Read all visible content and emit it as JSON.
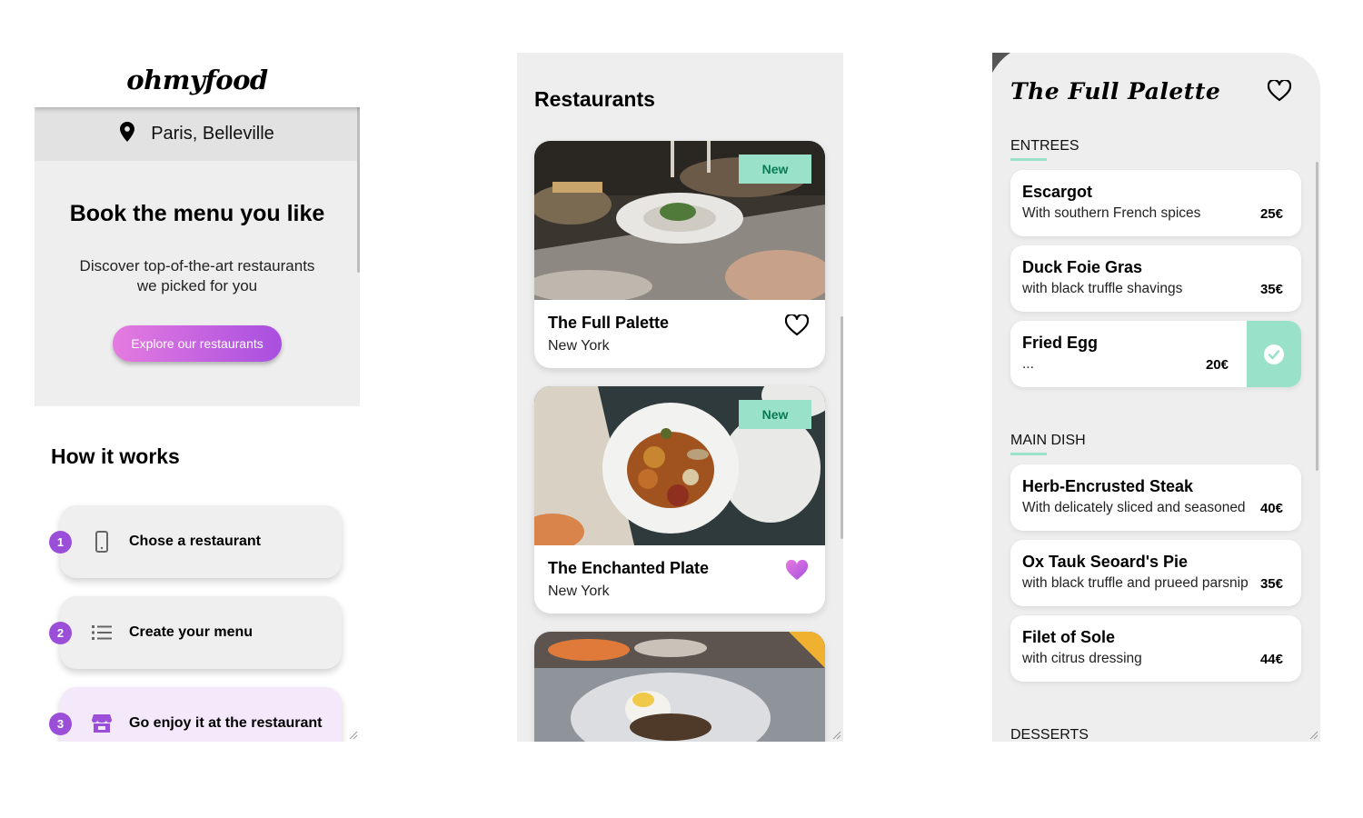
{
  "panel1": {
    "logo": "ohmyfood",
    "location": "Paris, Belleville",
    "hero": {
      "title": "Book the menu you like",
      "subtitle": "Discover top-of-the-art restaurants we picked for you",
      "button": "Explore our restaurants"
    },
    "how": {
      "title": "How it works",
      "steps": [
        {
          "num": "1",
          "label": "Chose a restaurant",
          "icon": "phone-icon"
        },
        {
          "num": "2",
          "label": "Create your menu",
          "icon": "list-icon"
        },
        {
          "num": "3",
          "label": "Go enjoy it at the restaurant",
          "icon": "store-icon"
        }
      ]
    }
  },
  "panel2": {
    "title": "Restaurants",
    "cards": [
      {
        "name": "The Full Palette",
        "city": "New York",
        "badge": "New",
        "liked": false
      },
      {
        "name": "The Enchanted Plate",
        "city": "New York",
        "badge": "New",
        "liked": true
      }
    ]
  },
  "panel3": {
    "title": "The Full Palette",
    "sections": [
      {
        "name": "ENTREES",
        "items": [
          {
            "name": "Escargot",
            "desc": "With southern French spices",
            "price": "25€"
          },
          {
            "name": "Duck Foie Gras",
            "desc": "with black truffle shavings",
            "price": "35€"
          },
          {
            "name": "Fried Egg",
            "desc": "...",
            "price": "20€",
            "selected": true
          }
        ]
      },
      {
        "name": "MAIN DISH",
        "items": [
          {
            "name": "Herb-Encrusted Steak",
            "desc": "With delicately sliced and seasoned",
            "price": "40€"
          },
          {
            "name": "Ox Tauk Seoard's Pie",
            "desc": "with black truffle and prueed parsnip",
            "price": "35€"
          },
          {
            "name": "Filet of Sole",
            "desc": "with citrus dressing",
            "price": "44€"
          }
        ]
      },
      {
        "name": "DESSERTS",
        "items": []
      }
    ]
  },
  "colors": {
    "accent_purple": "#9b4fd9",
    "gradient_start": "#e57be0",
    "gradient_end": "#a84fe0",
    "mint": "#99e2c9",
    "panel_bg": "#eeeeee"
  }
}
